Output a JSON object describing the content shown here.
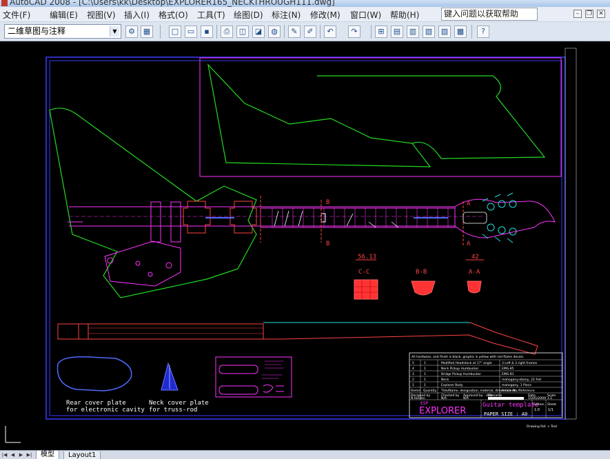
{
  "window": {
    "title": "AutoCAD 2008 - [C:\\Users\\kk\\Desktop\\EXPLORER165_NECKTHROUGH111.dwg]"
  },
  "menu": {
    "items": [
      "文件(F)",
      "编辑(E)",
      "视图(V)",
      "插入(I)",
      "格式(O)",
      "工具(T)",
      "绘图(D)",
      "标注(N)",
      "修改(M)",
      "窗口(W)",
      "帮助(H)"
    ]
  },
  "help": {
    "search_text": "键入问题以获取帮助"
  },
  "toolbar": {
    "workspace": "二维草图与注释"
  },
  "drawing": {
    "section_labels": {
      "c_c": "C-C",
      "b_b": "B-B",
      "a_a": "A-A"
    },
    "dims": {
      "c_width": "56.13",
      "a_width": "42"
    },
    "markers": {
      "a": "A",
      "b": "B"
    },
    "notes": {
      "rear_cover_1": "Rear cover plate",
      "rear_cover_2": "for electronic cavity",
      "neck_cover_1": "Neck cover plate",
      "neck_cover_2": "for truss-rod"
    },
    "title_block": {
      "header_note": "All hardware, and finish is black, graphic is yellow with red flame decals.",
      "rows": [
        [
          "5",
          "1",
          "Modified Headstock at 17° angle",
          "3 Left & 3 right frames"
        ],
        [
          "4",
          "1",
          "Neck Pickup Humbucker",
          "EMG-85"
        ],
        [
          "3",
          "1",
          "Bridge Pickup Humbucker",
          "EMG-81"
        ],
        [
          "2",
          "1",
          "Neck",
          "mahogany-ebony, 22 fret"
        ],
        [
          "1",
          "1",
          "Explorer Body",
          "mahogany, 1 Piece"
        ]
      ],
      "col_headers": [
        "Itemnr",
        "Quantity",
        "Title/Name, designation, material, dimension etc",
        "Article No./Reference"
      ],
      "sign_headers": [
        "Designed by",
        "Checked by",
        "Approved by - date",
        "Filename",
        "Date",
        "Scale"
      ],
      "sign_values": [
        "N.Heiden",
        "N/A",
        "N/A",
        "",
        "15/05/2009",
        "1:1"
      ],
      "brand": "ESP",
      "model": "EXPLORER",
      "title": "Guitar template",
      "paper_size": "PAPER SIZE : A0",
      "edition_label": "Edition",
      "sheet_label": "Sheet",
      "edition": "1.0",
      "sheet": "1/1",
      "footer": "Drawing Ref. + Text"
    }
  },
  "tabs": {
    "model": "模型",
    "layout1": "Layout1"
  }
}
